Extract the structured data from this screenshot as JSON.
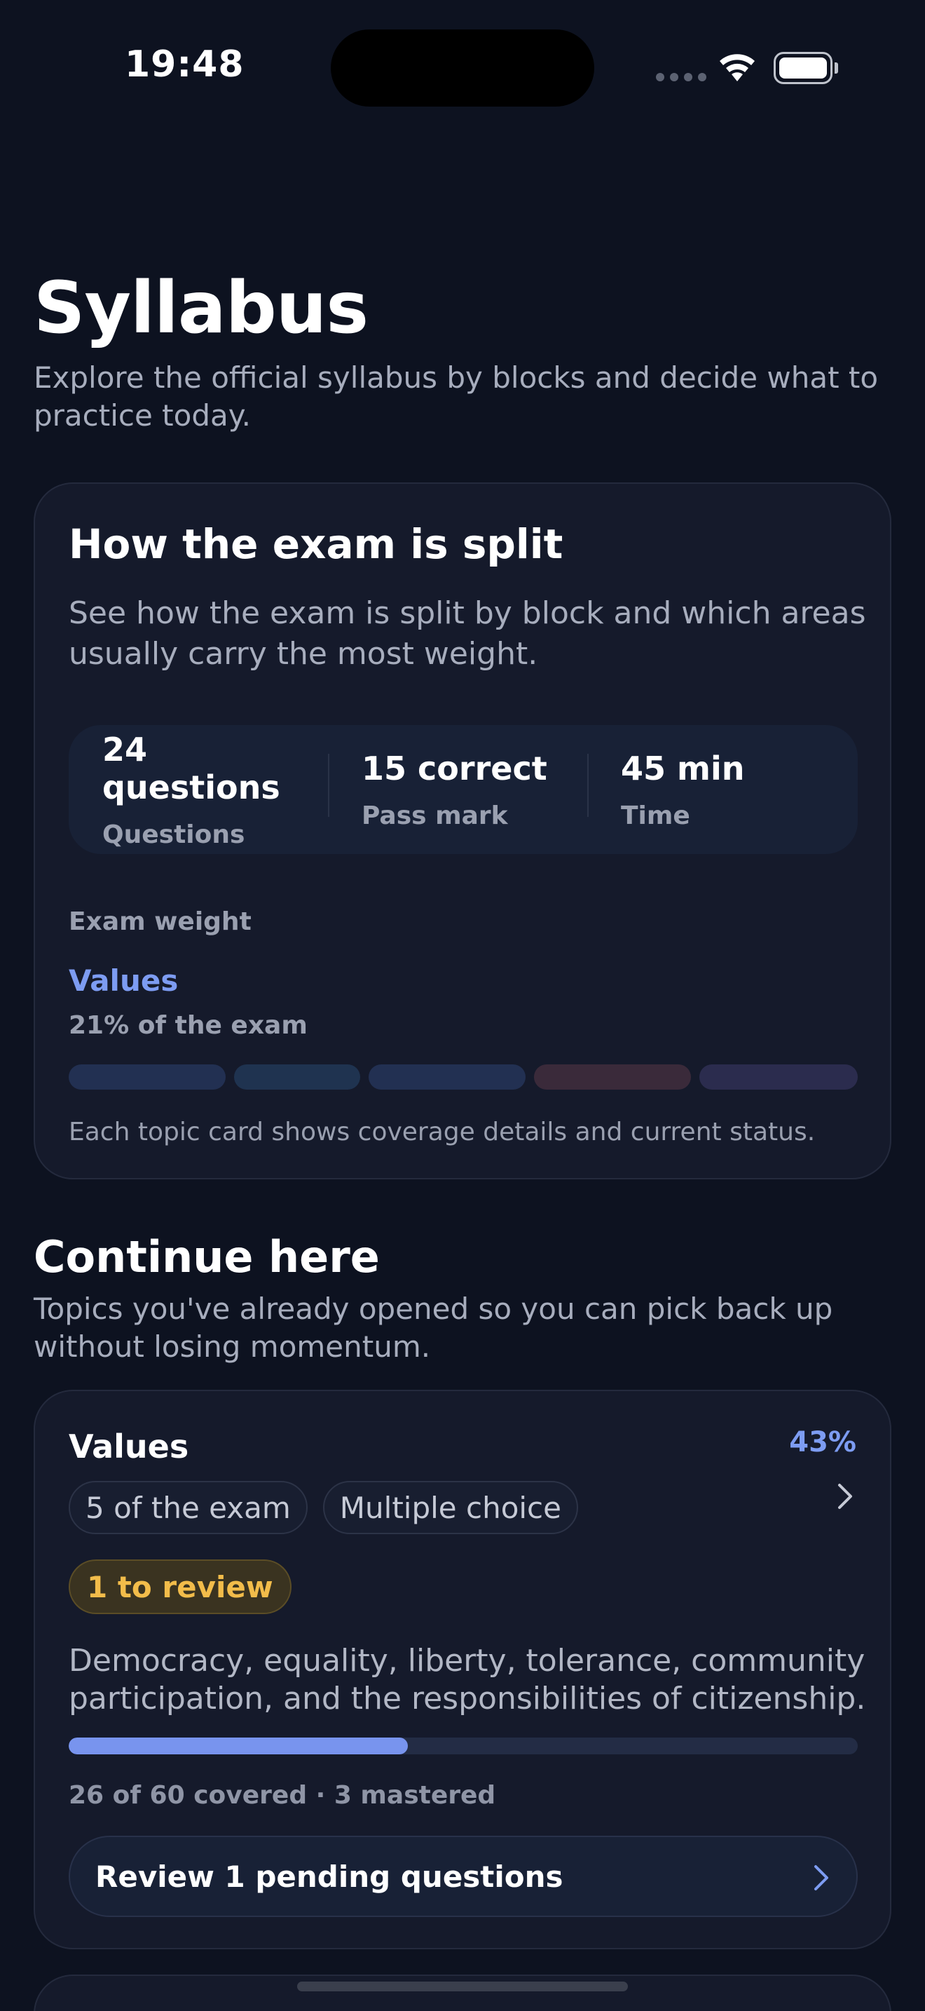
{
  "status_bar": {
    "time": "19:48"
  },
  "header": {
    "title": "Syllabus",
    "subtitle": "Explore the official syllabus by blocks and decide what to practice today."
  },
  "exam_card": {
    "title": "How the exam is split",
    "description": "See how the exam is split by block and which areas usually carry the most weight.",
    "stats": [
      {
        "value": "24 questions",
        "label": "Questions"
      },
      {
        "value": "15 correct",
        "label": "Pass mark"
      },
      {
        "value": "45 min",
        "label": "Time"
      }
    ],
    "weight_label": "Exam weight",
    "selected_topic": "Values",
    "selected_share": "21% of the exam",
    "segment_colors": [
      "#223052",
      "#1f3350",
      "#223052",
      "#3a2a3a",
      "#2b2c4e"
    ],
    "note": "Each topic card shows coverage details and current status."
  },
  "continue_section": {
    "title": "Continue here",
    "subtitle": "Topics you've already opened so you can pick back up without losing momentum."
  },
  "topic_card": {
    "name": "Values",
    "percent": "43%",
    "progress": 0.43,
    "chips": [
      "5 of the exam",
      "Multiple choice"
    ],
    "review_badge": "1 to review",
    "description": "Democracy, equality, liberty, tolerance, community participation, and the responsibilities of citizenship.",
    "coverage": "26 of 60 covered · 3 mastered",
    "review_button": "Review 1 pending questions"
  },
  "colors": {
    "background": "#0d1220",
    "card": "#151a2b",
    "accent": "#7d9cf2",
    "warning": "#f2bc4a"
  }
}
